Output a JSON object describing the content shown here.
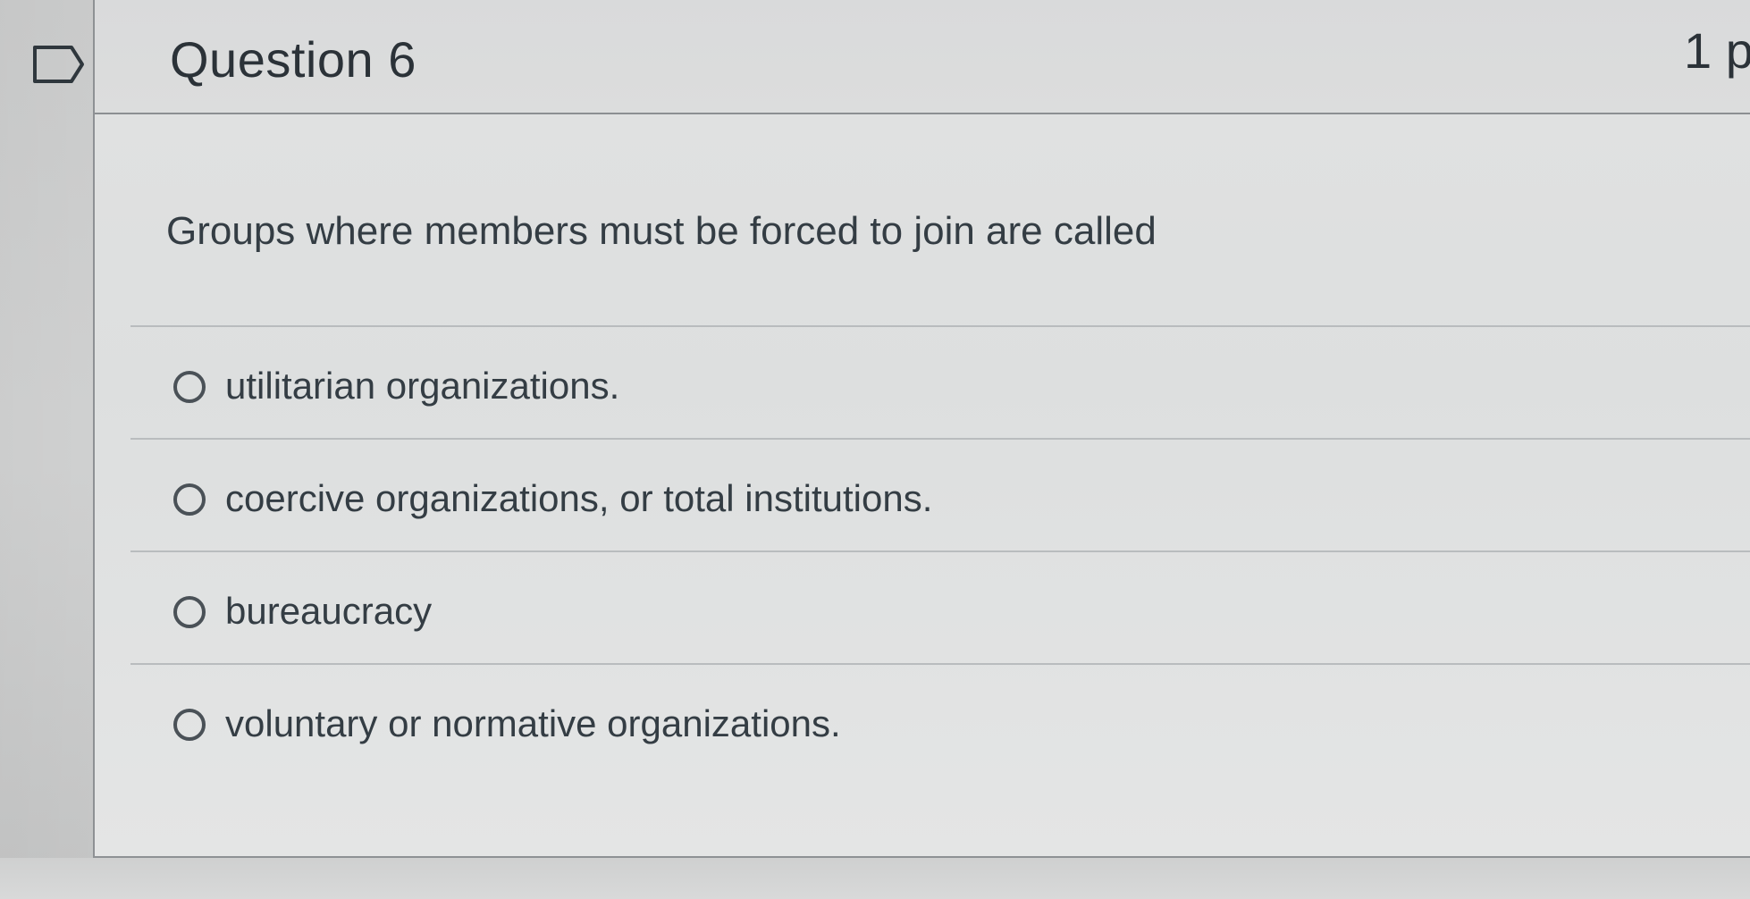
{
  "question": {
    "title": "Question 6",
    "points": "1 p",
    "text": "Groups where members must be forced to join are called",
    "answers": [
      {
        "label": "utilitarian organizations."
      },
      {
        "label": "coercive organizations, or total institutions."
      },
      {
        "label": "bureaucracy"
      },
      {
        "label": "voluntary or normative organizations."
      }
    ]
  },
  "icons": {
    "flag": "flag-outline-icon",
    "radio": "radio-unselected-icon"
  },
  "colors": {
    "text": "#343d44",
    "border": "#8e9194",
    "background": "#dddfdf"
  }
}
